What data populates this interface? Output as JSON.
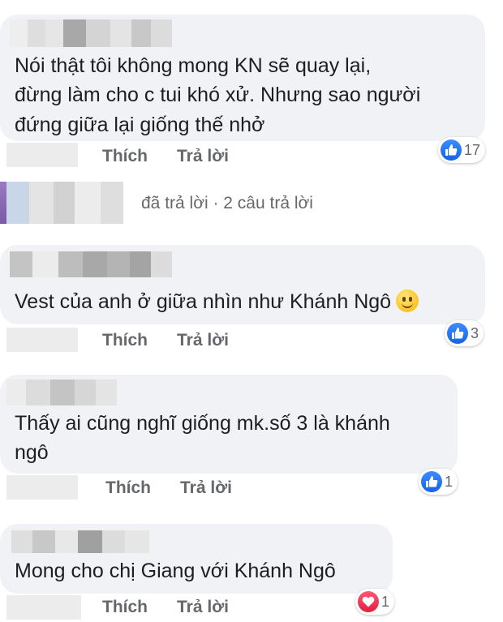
{
  "colors": {
    "bubble": "#f0f2f5",
    "like": "#1877f2",
    "love": "#f33e58",
    "meta": "#65676b"
  },
  "comments": [
    {
      "lines": [
        "Nói thật tôi không mong KN sẽ quay lại,",
        "đừng làm cho c tui khó xử. Nhưng sao người",
        "đứng giữa lại giống thế nhở"
      ],
      "like_label": "Thích",
      "reply_label": "Trả lời",
      "reaction": {
        "icon": "like-icon",
        "count": "17"
      }
    },
    {
      "lines": [
        "Vest của anh ở giữa nhìn như Khánh Ngô"
      ],
      "emoji": "slightly-smiling-face",
      "like_label": "Thích",
      "reply_label": "Trả lời",
      "reaction": {
        "icon": "like-icon",
        "count": "3"
      }
    },
    {
      "lines": [
        "Thấy ai cũng nghĩ giống mk.số 3 là khánh",
        "ngô"
      ],
      "like_label": "Thích",
      "reply_label": "Trả lời",
      "reaction": {
        "icon": "like-icon",
        "count": "1"
      }
    },
    {
      "lines": [
        "Mong cho chị Giang với Khánh Ngô"
      ],
      "like_label": "Thích",
      "reply_label": "Trả lời",
      "reaction": {
        "icon": "love-icon",
        "count": "1"
      }
    }
  ],
  "replies_summary": "đã trả lời · 2 câu trả lời"
}
